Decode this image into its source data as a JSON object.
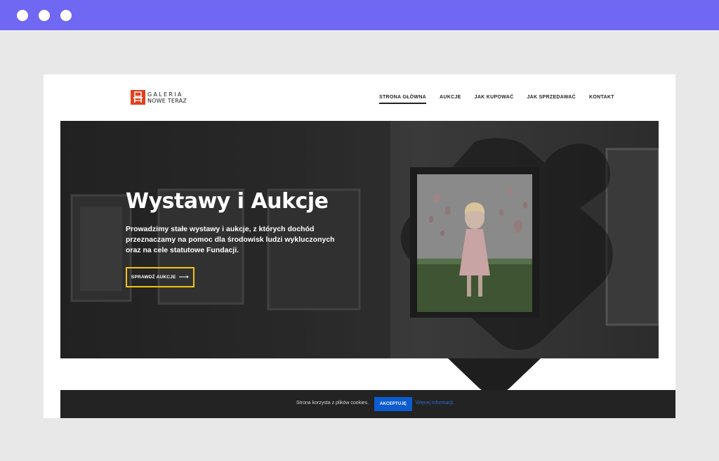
{
  "header": {
    "logo_line1": "GALERIA",
    "logo_line2": "NOWE TERAZ"
  },
  "nav": {
    "items": [
      {
        "label": "STRONA GŁÓWNA",
        "active": true
      },
      {
        "label": "AUKCJE"
      },
      {
        "label": "JAK KUPOWAĆ"
      },
      {
        "label": "JAK SPRZEDAWAĆ"
      },
      {
        "label": "KONTAKT"
      }
    ]
  },
  "hero": {
    "title": "Wystawy i Aukcje",
    "description": "Prowadzimy stałe wystawy i aukcje, z których dochód przeznaczamy na pomoc dla środowisk ludzi wykluczonych oraz na cele statutowe Fundacji.",
    "button_label": "SPRAWDŹ AUKCJE"
  },
  "cookie": {
    "text": "Strona korzysta z plików cookies.",
    "accept_label": "AKCEPTUJĘ",
    "more_label": "Więcej informacji."
  },
  "colors": {
    "browser_bar": "#7067f3",
    "logo": "#e0411f",
    "button_border": "#f1c40f",
    "accept_button": "#0c5bd0",
    "link": "#2d6bd6"
  },
  "icons": {
    "button_arrow": "arrow-right-icon",
    "logo": "chair-logo-icon"
  }
}
